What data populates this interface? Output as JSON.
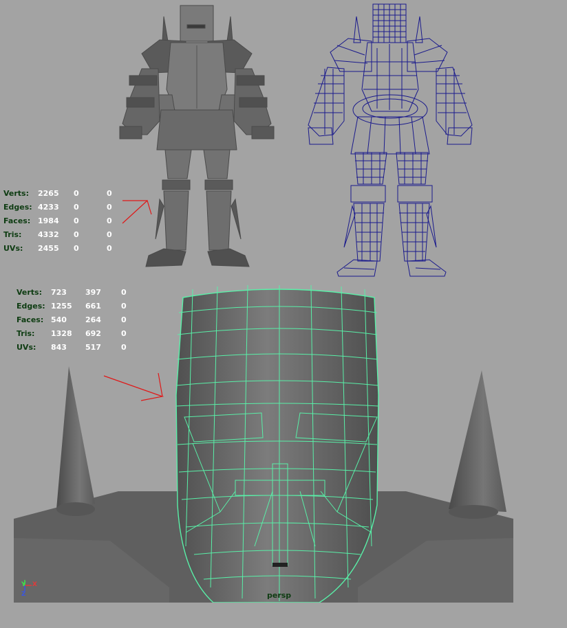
{
  "stats_top": {
    "rows": [
      {
        "label": "Verts:",
        "v1": "2265",
        "v2": "0",
        "v3": "0"
      },
      {
        "label": "Edges:",
        "v1": "4233",
        "v2": "0",
        "v3": "0"
      },
      {
        "label": "Faces:",
        "v1": "1984",
        "v2": "0",
        "v3": "0"
      },
      {
        "label": "Tris:",
        "v1": "4332",
        "v2": "0",
        "v3": "0"
      },
      {
        "label": "UVs:",
        "v1": "2455",
        "v2": "0",
        "v3": "0"
      }
    ]
  },
  "stats_bottom": {
    "rows": [
      {
        "label": "Verts:",
        "v1": "723",
        "v2": "397",
        "v3": "0"
      },
      {
        "label": "Edges:",
        "v1": "1255",
        "v2": "661",
        "v3": "0"
      },
      {
        "label": "Faces:",
        "v1": "540",
        "v2": "264",
        "v3": "0"
      },
      {
        "label": "Tris:",
        "v1": "1328",
        "v2": "692",
        "v3": "0"
      },
      {
        "label": "UVs:",
        "v1": "843",
        "v2": "517",
        "v3": "0"
      }
    ]
  },
  "viewport": {
    "camera_label": "persp",
    "axis_labels": {
      "y": "Y",
      "x": "X",
      "z": "Z"
    }
  },
  "colors": {
    "background": "#a3a3a3",
    "hud_label": "#0e3c12",
    "hud_value": "#ffffff",
    "wireframe_blue": "#1a1a8c",
    "selection_wire": "#59f0a8",
    "annotation_arrow": "#e01818",
    "axis_y": "#3fe04a",
    "axis_x": "#e23a3a",
    "axis_z": "#3a56e2"
  }
}
